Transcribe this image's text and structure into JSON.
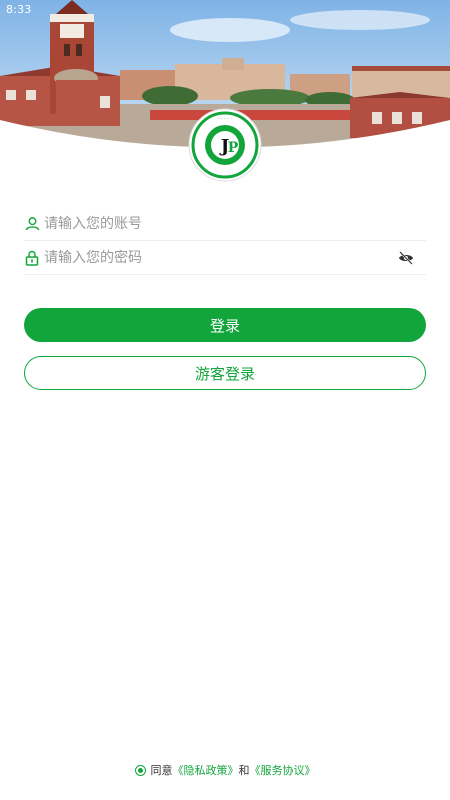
{
  "status_bar": {
    "time": "8:33"
  },
  "login_form": {
    "username": {
      "placeholder": "请输入您的账号",
      "value": ""
    },
    "password": {
      "placeholder": "请输入您的密码",
      "value": ""
    }
  },
  "buttons": {
    "login_label": "登录",
    "guest_login_label": "游客登录"
  },
  "agreement": {
    "agree_text": "同意",
    "privacy_link": "《隐私政策》",
    "and_text": "和",
    "service_link": "《服务协议》"
  },
  "logo": {
    "initials": "JP",
    "ring_text": "JIANGYIN POLYTECHNIC COLLEGE"
  },
  "icons": {
    "user": "user-outline-icon",
    "lock": "lock-icon",
    "eye": "eye-slash-icon",
    "radio": "radio-selected-icon"
  },
  "colors": {
    "accent": "#12a53c",
    "placeholder": "#999999",
    "text": "#333333"
  }
}
